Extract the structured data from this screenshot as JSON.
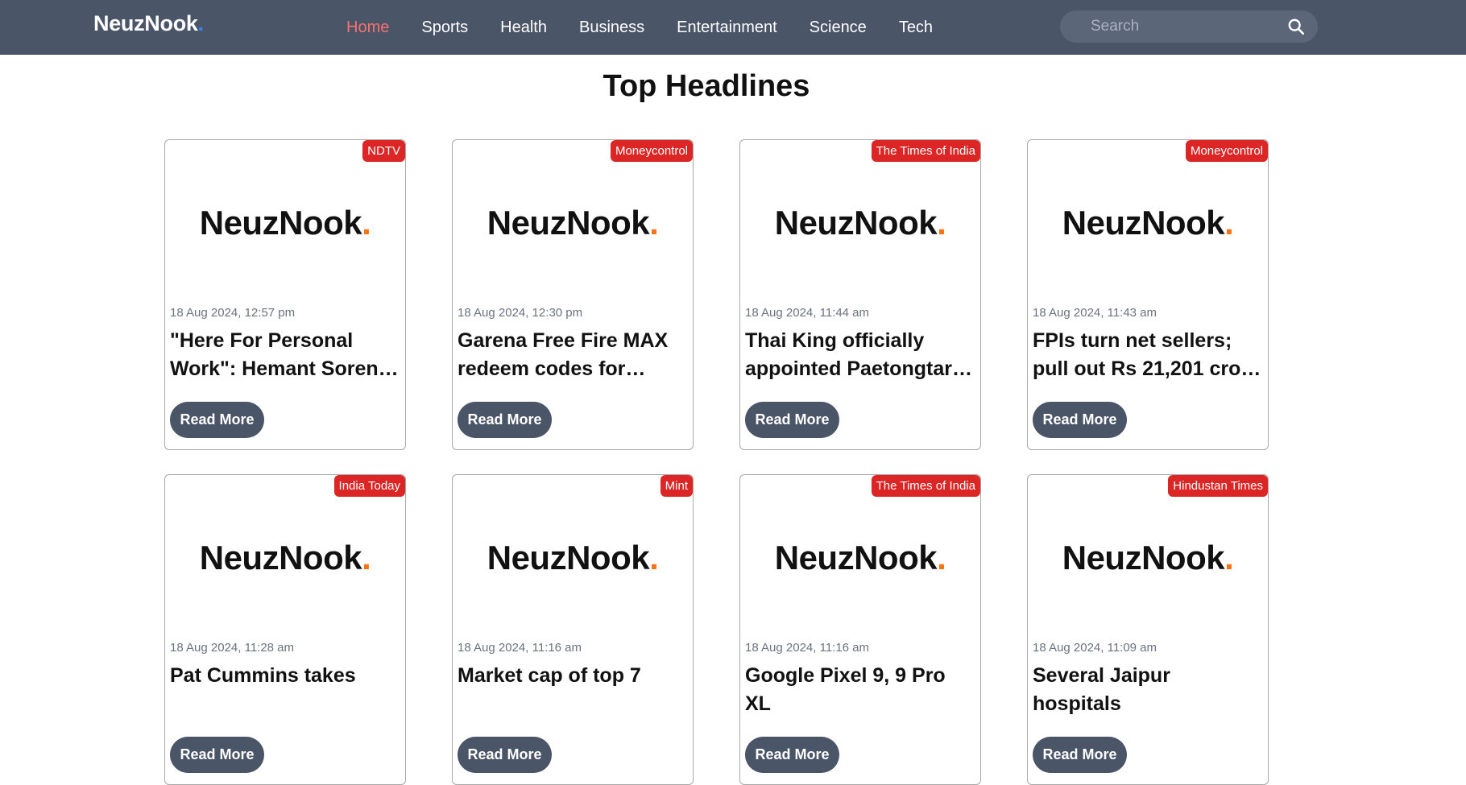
{
  "navbar": {
    "brand": "NeuzNook",
    "brand_dot": ".",
    "links": [
      {
        "label": "Home",
        "active": true
      },
      {
        "label": "Sports",
        "active": false
      },
      {
        "label": "Health",
        "active": false
      },
      {
        "label": "Business",
        "active": false
      },
      {
        "label": "Entertainment",
        "active": false
      },
      {
        "label": "Science",
        "active": false
      },
      {
        "label": "Tech",
        "active": false
      }
    ],
    "search": {
      "placeholder": "Search",
      "value": "",
      "icon": "search-icon"
    }
  },
  "page_title": "Top Headlines",
  "cards": [
    {
      "source": "NDTV",
      "logo_text": "NeuzNook",
      "logo_dot": ".",
      "date": "18 Aug 2024, 12:57 pm",
      "title": "\"Here For Personal Work\": Hemant Soren…",
      "button": "Read More"
    },
    {
      "source": "Moneycontrol",
      "logo_text": "NeuzNook",
      "logo_dot": ".",
      "date": "18 Aug 2024, 12:30 pm",
      "title": "Garena Free Fire MAX redeem codes for…",
      "button": "Read More"
    },
    {
      "source": "The Times of India",
      "logo_text": "NeuzNook",
      "logo_dot": ".",
      "date": "18 Aug 2024, 11:44 am",
      "title": "Thai King officially appointed Paetongtar…",
      "button": "Read More"
    },
    {
      "source": "Moneycontrol",
      "logo_text": "NeuzNook",
      "logo_dot": ".",
      "date": "18 Aug 2024, 11:43 am",
      "title": "FPIs turn net sellers; pull out Rs 21,201 cro…",
      "button": "Read More"
    },
    {
      "source": "India Today",
      "logo_text": "NeuzNook",
      "logo_dot": ".",
      "date": "18 Aug 2024, 11:28 am",
      "title": "Pat Cummins takes",
      "button": "Read More"
    },
    {
      "source": "Mint",
      "logo_text": "NeuzNook",
      "logo_dot": ".",
      "date": "18 Aug 2024, 11:16 am",
      "title": "Market cap of top 7",
      "button": "Read More"
    },
    {
      "source": "The Times of India",
      "logo_text": "NeuzNook",
      "logo_dot": ".",
      "date": "18 Aug 2024, 11:16 am",
      "title": "Google Pixel 9, 9 Pro XL",
      "button": "Read More"
    },
    {
      "source": "Hindustan Times",
      "logo_text": "NeuzNook",
      "logo_dot": ".",
      "date": "18 Aug 2024, 11:09 am",
      "title": "Several Jaipur hospitals",
      "button": "Read More"
    }
  ],
  "colors": {
    "navbar_bg": "#4a5568",
    "active_link": "#f87171",
    "badge_bg": "#dc2626",
    "logo_dot": "#f97316",
    "brand_dot": "#3b82f6",
    "button_bg": "#4a5568"
  }
}
